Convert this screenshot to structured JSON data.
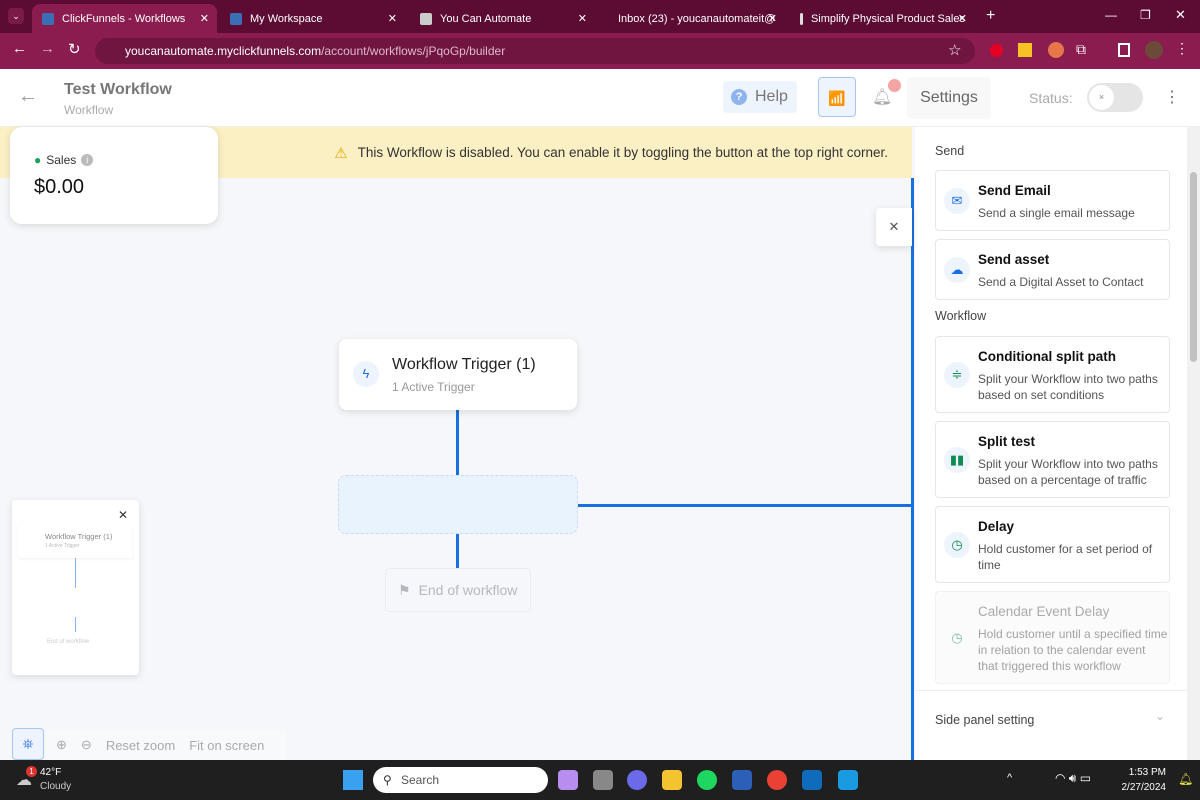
{
  "browser": {
    "tabs": [
      {
        "label": "ClickFunnels - Workflows",
        "active": true
      },
      {
        "label": "My Workspace"
      },
      {
        "label": "You Can Automate"
      },
      {
        "label": "Inbox (23) - youcanautomateit@"
      },
      {
        "label": "Simplify Physical Product Sales"
      }
    ],
    "url_host": "youcanautomate.myclickfunnels.com",
    "url_path": "/account/workflows/jPqoGp/builder"
  },
  "header": {
    "title": "Test Workflow",
    "subtitle": "Workflow",
    "help": "Help",
    "settings": "Settings",
    "status_label": "Status:",
    "toggle_off_glyph": "×"
  },
  "banner": {
    "text": "This Workflow is disabled. You can enable it by toggling the button at the top right corner."
  },
  "sales": {
    "label": "Sales",
    "value": "$0.00"
  },
  "canvas": {
    "trigger_title": "Workflow Trigger (1)",
    "trigger_sub": "1 Active Trigger",
    "end": "End of workflow"
  },
  "minimap": {
    "trigger_title": "Workflow Trigger (1)",
    "trigger_sub": "1 Active Trigger",
    "end": "End of workflow"
  },
  "zoombar": {
    "reset": "Reset zoom",
    "fit": "Fit on screen"
  },
  "panel": {
    "send_section": "Send",
    "workflow_section": "Workflow",
    "items": [
      {
        "title": "Send Email",
        "desc": "Send a single email message"
      },
      {
        "title": "Send asset",
        "desc": "Send a Digital Asset to Contact"
      },
      {
        "title": "Conditional split path",
        "desc": "Split your Workflow into two paths based on set conditions"
      },
      {
        "title": "Split test",
        "desc": "Split your Workflow into two paths based on a percentage of traffic"
      },
      {
        "title": "Delay",
        "desc": "Hold customer for a set period of time"
      },
      {
        "title": "Calendar Event Delay",
        "desc": "Hold customer until a specified time in relation to the calendar event that triggered this workflow"
      }
    ],
    "footer": "Side panel setting"
  },
  "taskbar": {
    "temp": "42°F",
    "weather": "Cloudy",
    "badge": "1",
    "search": "Search",
    "time": "1:53 PM",
    "date": "2/27/2024"
  }
}
